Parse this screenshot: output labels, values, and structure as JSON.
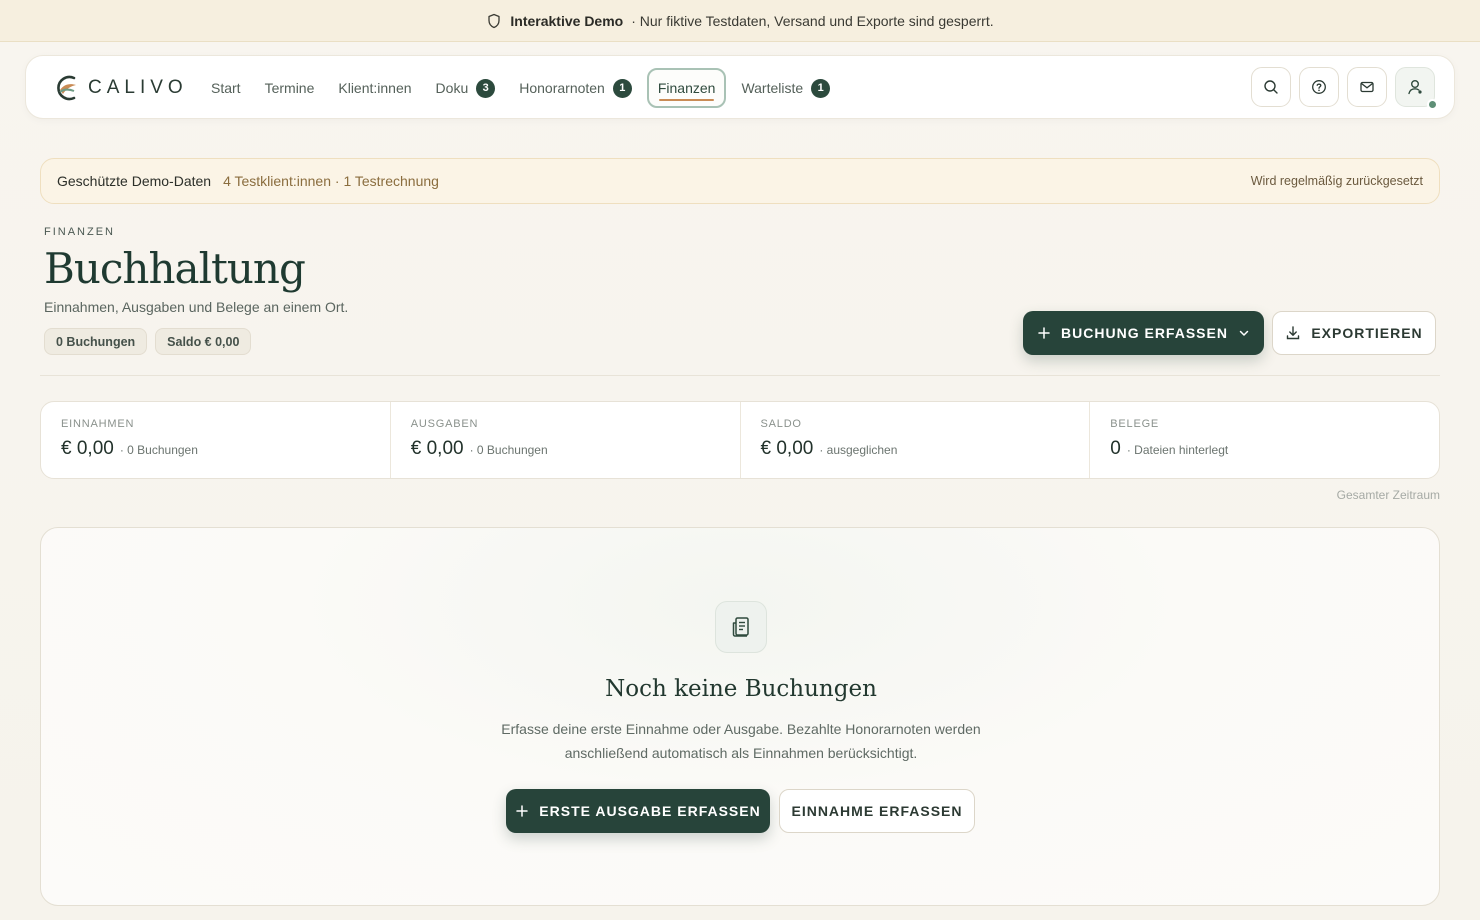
{
  "banner": {
    "bold": "Interaktive Demo",
    "text": "· Nur fiktive Testdaten, Versand und Exporte sind gesperrt.",
    "icon": "shield-icon"
  },
  "brand": {
    "name": "CALIVO"
  },
  "nav": {
    "items": [
      {
        "label": "Start",
        "badge": ""
      },
      {
        "label": "Termine",
        "badge": ""
      },
      {
        "label": "Klient:innen",
        "badge": ""
      },
      {
        "label": "Doku",
        "badge": "3"
      },
      {
        "label": "Honorarnoten",
        "badge": "1"
      },
      {
        "label": "Finanzen",
        "badge": "",
        "active": true
      },
      {
        "label": "Warteliste",
        "badge": "1"
      }
    ],
    "actions": [
      "search-icon",
      "help-icon",
      "mail-icon",
      "user-icon"
    ]
  },
  "protected": {
    "title": "Geschützte Demo-Daten",
    "meta": "4 Testklient:innen · 1 Testrechnung",
    "right": "Wird regelmäßig zurückgesetzt"
  },
  "header": {
    "eyebrow": "FINANZEN",
    "title": "Buchhaltung",
    "subtitle": "Einnahmen, Ausgaben und Belege an einem Ort.",
    "chips": [
      "0 Buchungen",
      "Saldo € 0,00"
    ],
    "primary_label": "BUCHUNG ERFASSEN",
    "export_label": "EXPORTIEREN"
  },
  "stats": [
    {
      "label": "EINNAHMEN",
      "value": "€ 0,00",
      "meta": "· 0 Buchungen"
    },
    {
      "label": "AUSGABEN",
      "value": "€ 0,00",
      "meta": "· 0 Buchungen"
    },
    {
      "label": "SALDO",
      "value": "€ 0,00",
      "meta": "· ausgeglichen"
    },
    {
      "label": "BELEGE",
      "value": "0",
      "meta": "· Dateien hinterlegt"
    }
  ],
  "period": "Gesamter Zeitraum",
  "empty": {
    "title": "Noch keine Buchungen",
    "text": "Erfasse deine erste Einnahme oder Ausgabe. Bezahlte Honorarnoten werden anschließend automatisch als Einnahmen berücksichtigt.",
    "primary_label": "ERSTE AUSGABE ERFASSEN",
    "secondary_label": "EINNAHME ERFASSEN"
  },
  "colors": {
    "accent": "#27443a",
    "underline": "#c98b55",
    "banner_bg": "#f6efdf"
  }
}
